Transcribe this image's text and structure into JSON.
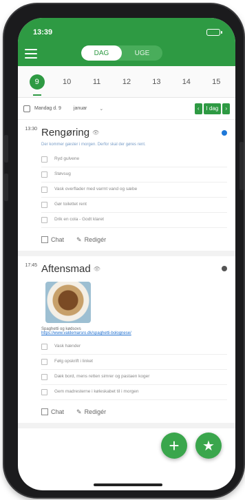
{
  "status_bar": {
    "time": "13:39"
  },
  "tabs": [
    {
      "label": "DAG"
    },
    {
      "label": "UGE"
    }
  ],
  "date_strip": [
    {
      "day": "",
      "num": "9"
    },
    {
      "day": "",
      "num": "10"
    },
    {
      "day": "",
      "num": "11"
    },
    {
      "day": "",
      "num": "12"
    },
    {
      "day": "",
      "num": "13"
    },
    {
      "day": "",
      "num": "14"
    },
    {
      "day": "",
      "num": "15"
    }
  ],
  "week_row": {
    "label": "Mandag d. 9",
    "month": "januar",
    "today_label": "I dag"
  },
  "events": [
    {
      "time": "13:30",
      "title": "Rengøring",
      "description": "Der kommer gæster i morgen. Derfor skal der gøres rent.",
      "tasks": [
        "Ryd gulvene",
        "Støvsug",
        "Vask overflader med varmt vand og sæbe",
        "Gør toilettet rent",
        "Drik en cola - Godt klaret"
      ],
      "chat_label": "Chat",
      "edit_label": "Redigér"
    },
    {
      "time": "17:45",
      "title": "Aftensmad",
      "description": "Spaghetti og kødsovs",
      "link": "https://www.valdemarsro.dk/spaghetti-bolognese/",
      "tasks": [
        "Vask hænder",
        "Følg opskrift i linket",
        "Dæk bord, mens retten simrer og pastaen koger",
        "Gem madresterne i køleskabet til i morgen"
      ],
      "chat_label": "Chat",
      "edit_label": "Redigér"
    }
  ],
  "fab": {
    "add": "+",
    "favorite": "★"
  },
  "colors": {
    "primary": "#2e9a43",
    "dot_blue": "#1e78d8",
    "dot_grey": "#555555",
    "link": "#1e6fd0"
  }
}
